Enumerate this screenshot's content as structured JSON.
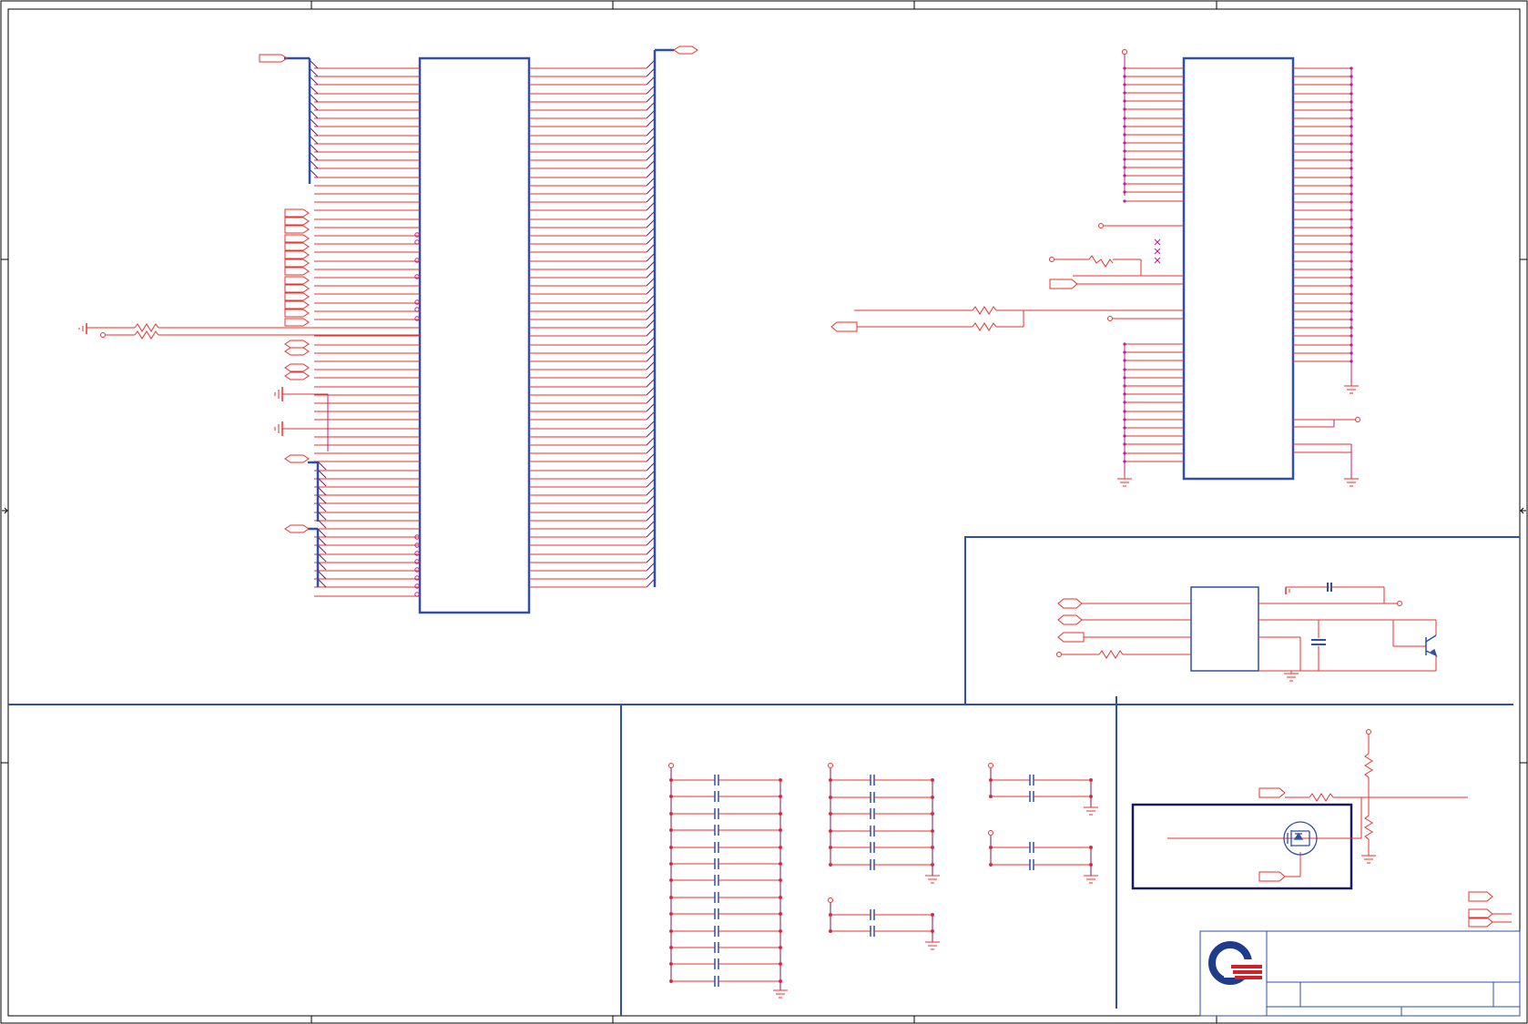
{
  "sheet": {
    "title_block": {
      "logo_name": "company-logo",
      "title": "",
      "size": "",
      "document_number": "",
      "revision": "",
      "date": "",
      "sheet": ""
    }
  },
  "colors": {
    "border": "#000000",
    "component": "#2f4fa8",
    "wire": "#e8322c",
    "bus": "#7a1a5a",
    "junction": "#c2188f",
    "logo_blue": "#1d3c8c",
    "logo_red": "#d0202a"
  },
  "diagram": {
    "kind": "schematic",
    "blocks": [
      {
        "id": "main-connector",
        "icon": "ic-block"
      },
      {
        "id": "secondary-ic",
        "icon": "ic-block"
      },
      {
        "id": "regulator-circuit",
        "icon": "ic-block"
      },
      {
        "id": "decoupling-caps",
        "icon": "capacitor-array"
      },
      {
        "id": "mosfet-switch",
        "icon": "mosfet-icon"
      },
      {
        "id": "title-block",
        "icon": "title-block"
      }
    ]
  }
}
